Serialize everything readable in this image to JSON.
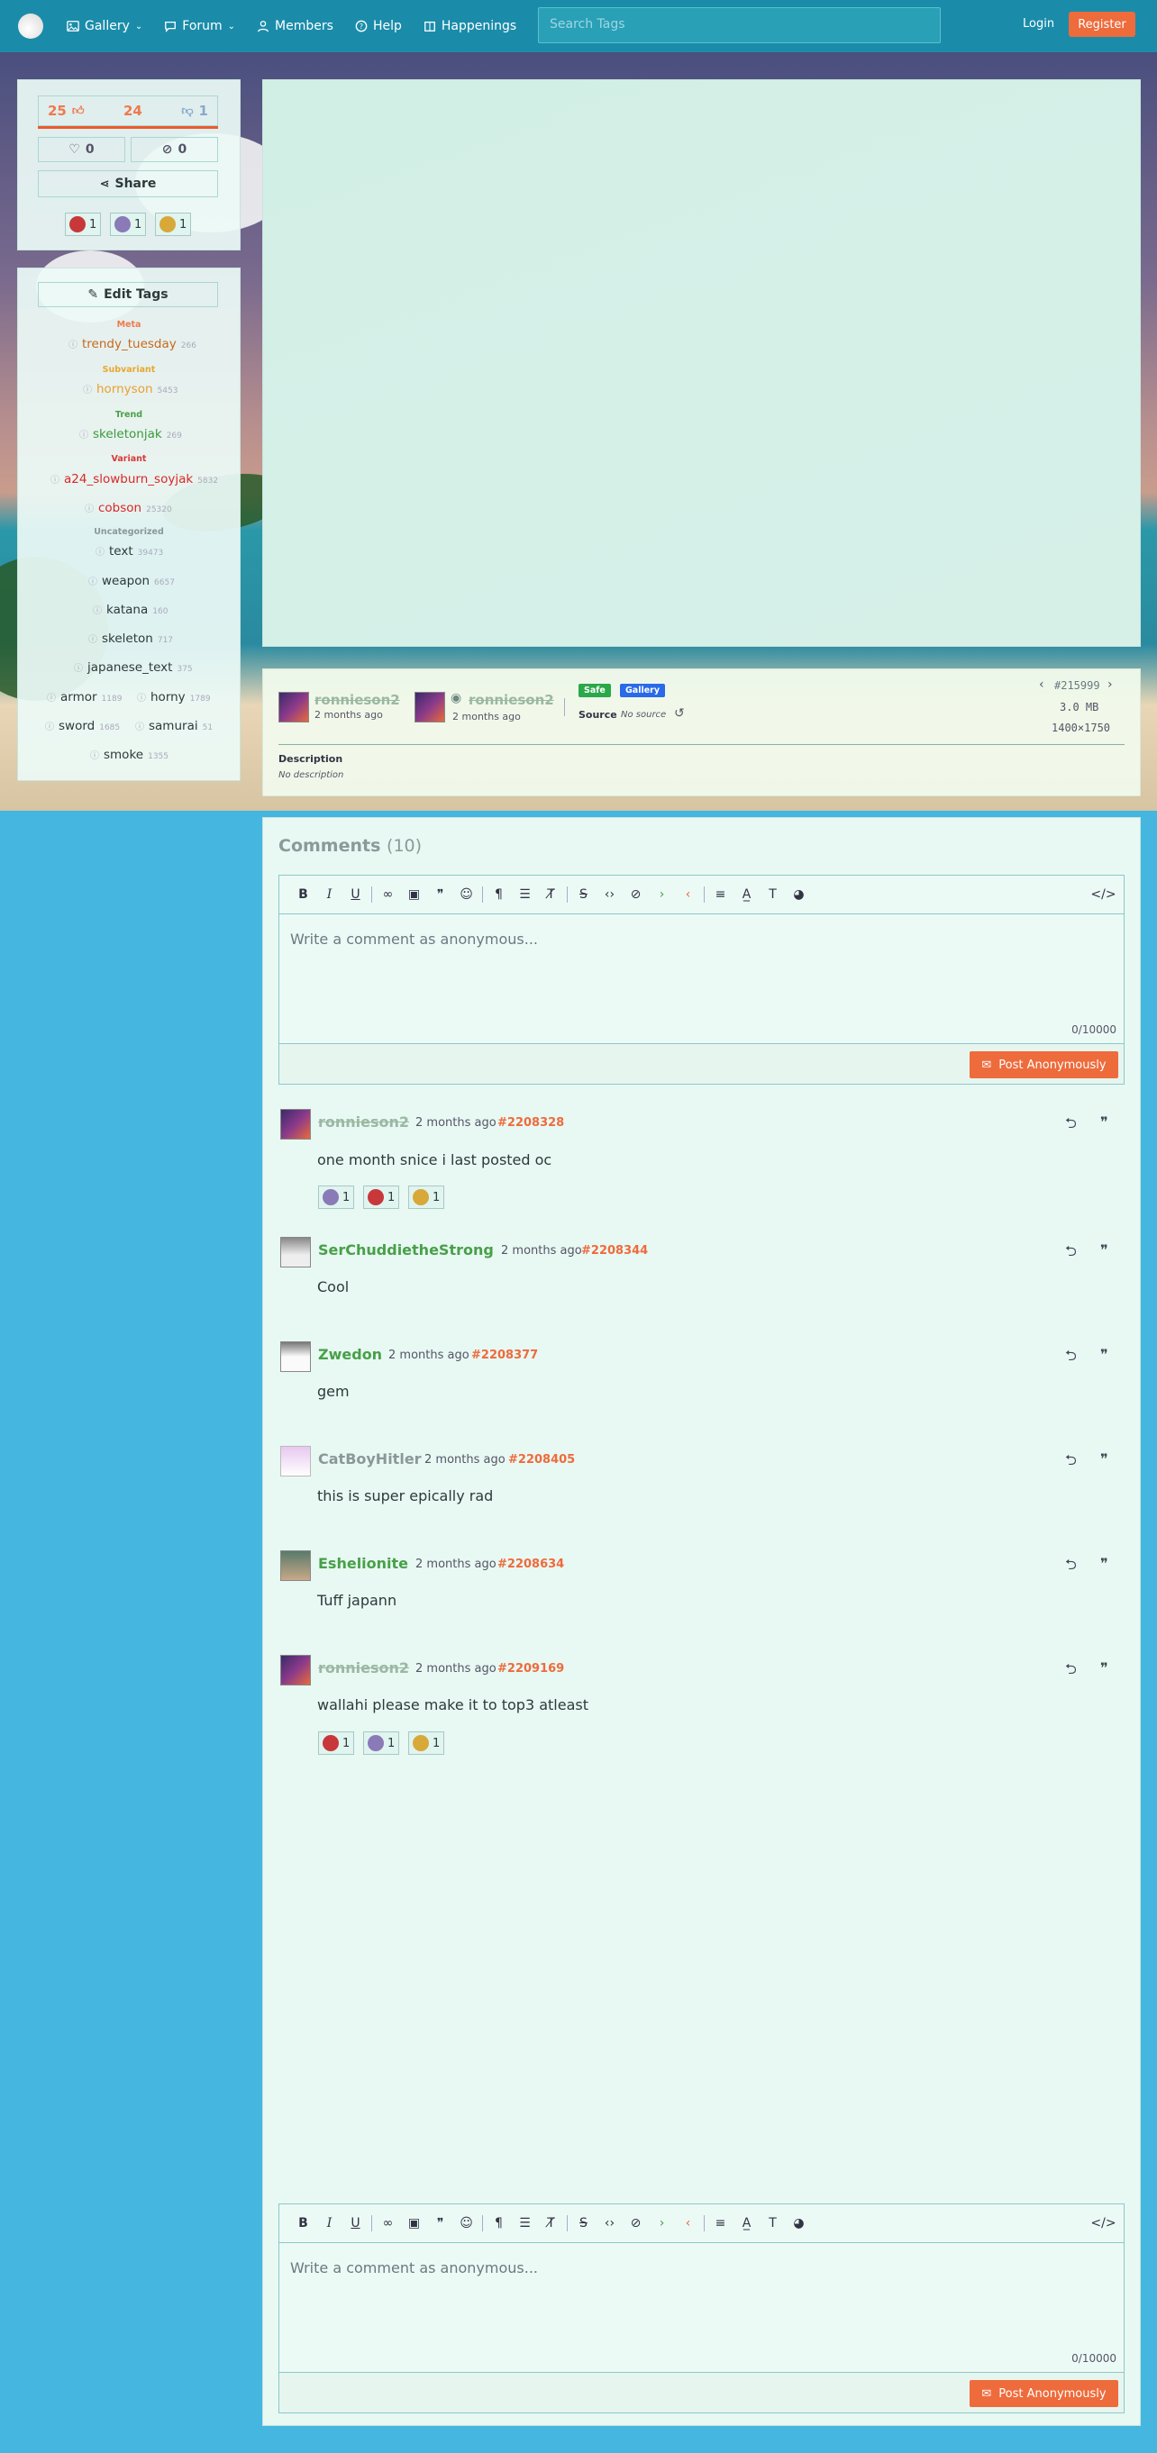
{
  "nav": {
    "items": [
      {
        "label": "Gallery",
        "icon": "image-icon",
        "dropdown": true
      },
      {
        "label": "Forum",
        "icon": "chat-icon",
        "dropdown": true
      },
      {
        "label": "Members",
        "icon": "person-icon",
        "dropdown": false
      },
      {
        "label": "Help",
        "icon": "help-icon",
        "dropdown": false
      },
      {
        "label": "Happenings",
        "icon": "calendar-icon",
        "dropdown": false
      }
    ],
    "search_placeholder": "Search Tags",
    "login": "Login",
    "register": "Register"
  },
  "votes": {
    "up": "25",
    "score": "24",
    "down": "1",
    "favorites": "0",
    "hidden": "0",
    "share": "Share"
  },
  "reactions": [
    {
      "icon": "red-reaction-icon",
      "count": "1",
      "color": "#c8383a"
    },
    {
      "icon": "purple-reaction-icon",
      "count": "1",
      "color": "#8a7ab8"
    },
    {
      "icon": "gold-reaction-icon",
      "count": "1",
      "color": "#d8a838"
    }
  ],
  "tags": {
    "edit_label": "Edit Tags",
    "categories": [
      {
        "name": "Meta",
        "color": "#ee7a4c",
        "tags": [
          {
            "name": "trendy_tuesday",
            "count": "266"
          }
        ]
      },
      {
        "name": "Subvariant",
        "color": "#e8a830",
        "tags": [
          {
            "name": "hornyson",
            "count": "5453"
          }
        ]
      },
      {
        "name": "Trend",
        "color": "#48a048",
        "tags": [
          {
            "name": "skeletonjak",
            "count": "269"
          }
        ]
      },
      {
        "name": "Variant",
        "color": "#d83838",
        "tags": [
          {
            "name": "a24_slowburn_soyjak",
            "count": "5832"
          },
          {
            "name": "cobson",
            "count": "25320"
          }
        ]
      },
      {
        "name": "Uncategorized",
        "color": "#8a9898",
        "tags": [
          {
            "name": "text",
            "count": "39473"
          },
          {
            "name": "weapon",
            "count": "6657"
          },
          {
            "name": "katana",
            "count": "160"
          },
          {
            "name": "skeleton",
            "count": "717"
          },
          {
            "name": "japanese_text",
            "count": "375"
          },
          {
            "name": "armor",
            "count": "1189"
          },
          {
            "name": "horny",
            "count": "1789"
          },
          {
            "name": "sword",
            "count": "1685"
          },
          {
            "name": "samurai",
            "count": "51"
          },
          {
            "name": "smoke",
            "count": "1355"
          }
        ]
      }
    ]
  },
  "post": {
    "uploader": "ronnieson2",
    "uploader_time": "2 months ago",
    "approver": "ronnieson2",
    "approver_time": "2 months ago",
    "rating": "Safe",
    "board": "Gallery",
    "source_label": "Source",
    "source_value": "No source",
    "id": "#215999",
    "size": "3.0 MB",
    "dimensions": "1400×1750",
    "description_label": "Description",
    "description_value": "No description"
  },
  "comments_section": {
    "title": "Comments",
    "count": "(10)",
    "placeholder": "Write a comment as anonymous...",
    "counter": "0/10000",
    "post_button": "Post Anonymously"
  },
  "comments": [
    {
      "user": "ronnieson2",
      "style": "strike",
      "time": "2 months ago",
      "id": "#2208328",
      "text": "one month snice i last posted oc",
      "reactions": [
        [
          "purple-reaction-icon",
          "1"
        ],
        [
          "red-reaction-icon",
          "1"
        ],
        [
          "gold-reaction-icon",
          "1"
        ]
      ]
    },
    {
      "user": "SerChuddietheStrong",
      "style": "green",
      "time": "2 months ago",
      "id": "#2208344",
      "text": "Cool",
      "reactions": []
    },
    {
      "user": "Zwedon",
      "style": "green",
      "time": "2 months ago",
      "id": "#2208377",
      "text": "gem",
      "reactions": []
    },
    {
      "user": "CatBoyHitler",
      "style": "gray",
      "time": "2 months ago",
      "id": "#2208405",
      "text": "this is super epically rad",
      "reactions": []
    },
    {
      "user": "Eshelionite",
      "style": "green",
      "time": "2 months ago",
      "id": "#2208634",
      "text": "Tuff japann",
      "reactions": []
    },
    {
      "user": "ronnieson2",
      "style": "strike",
      "time": "2 months ago",
      "id": "#2209169",
      "text": "wallahi please make it to top3 atleast",
      "reactions": [
        [
          "red-reaction-icon",
          "1"
        ],
        [
          "purple-reaction-icon",
          "1"
        ],
        [
          "gold-reaction-icon",
          "1"
        ]
      ]
    }
  ]
}
